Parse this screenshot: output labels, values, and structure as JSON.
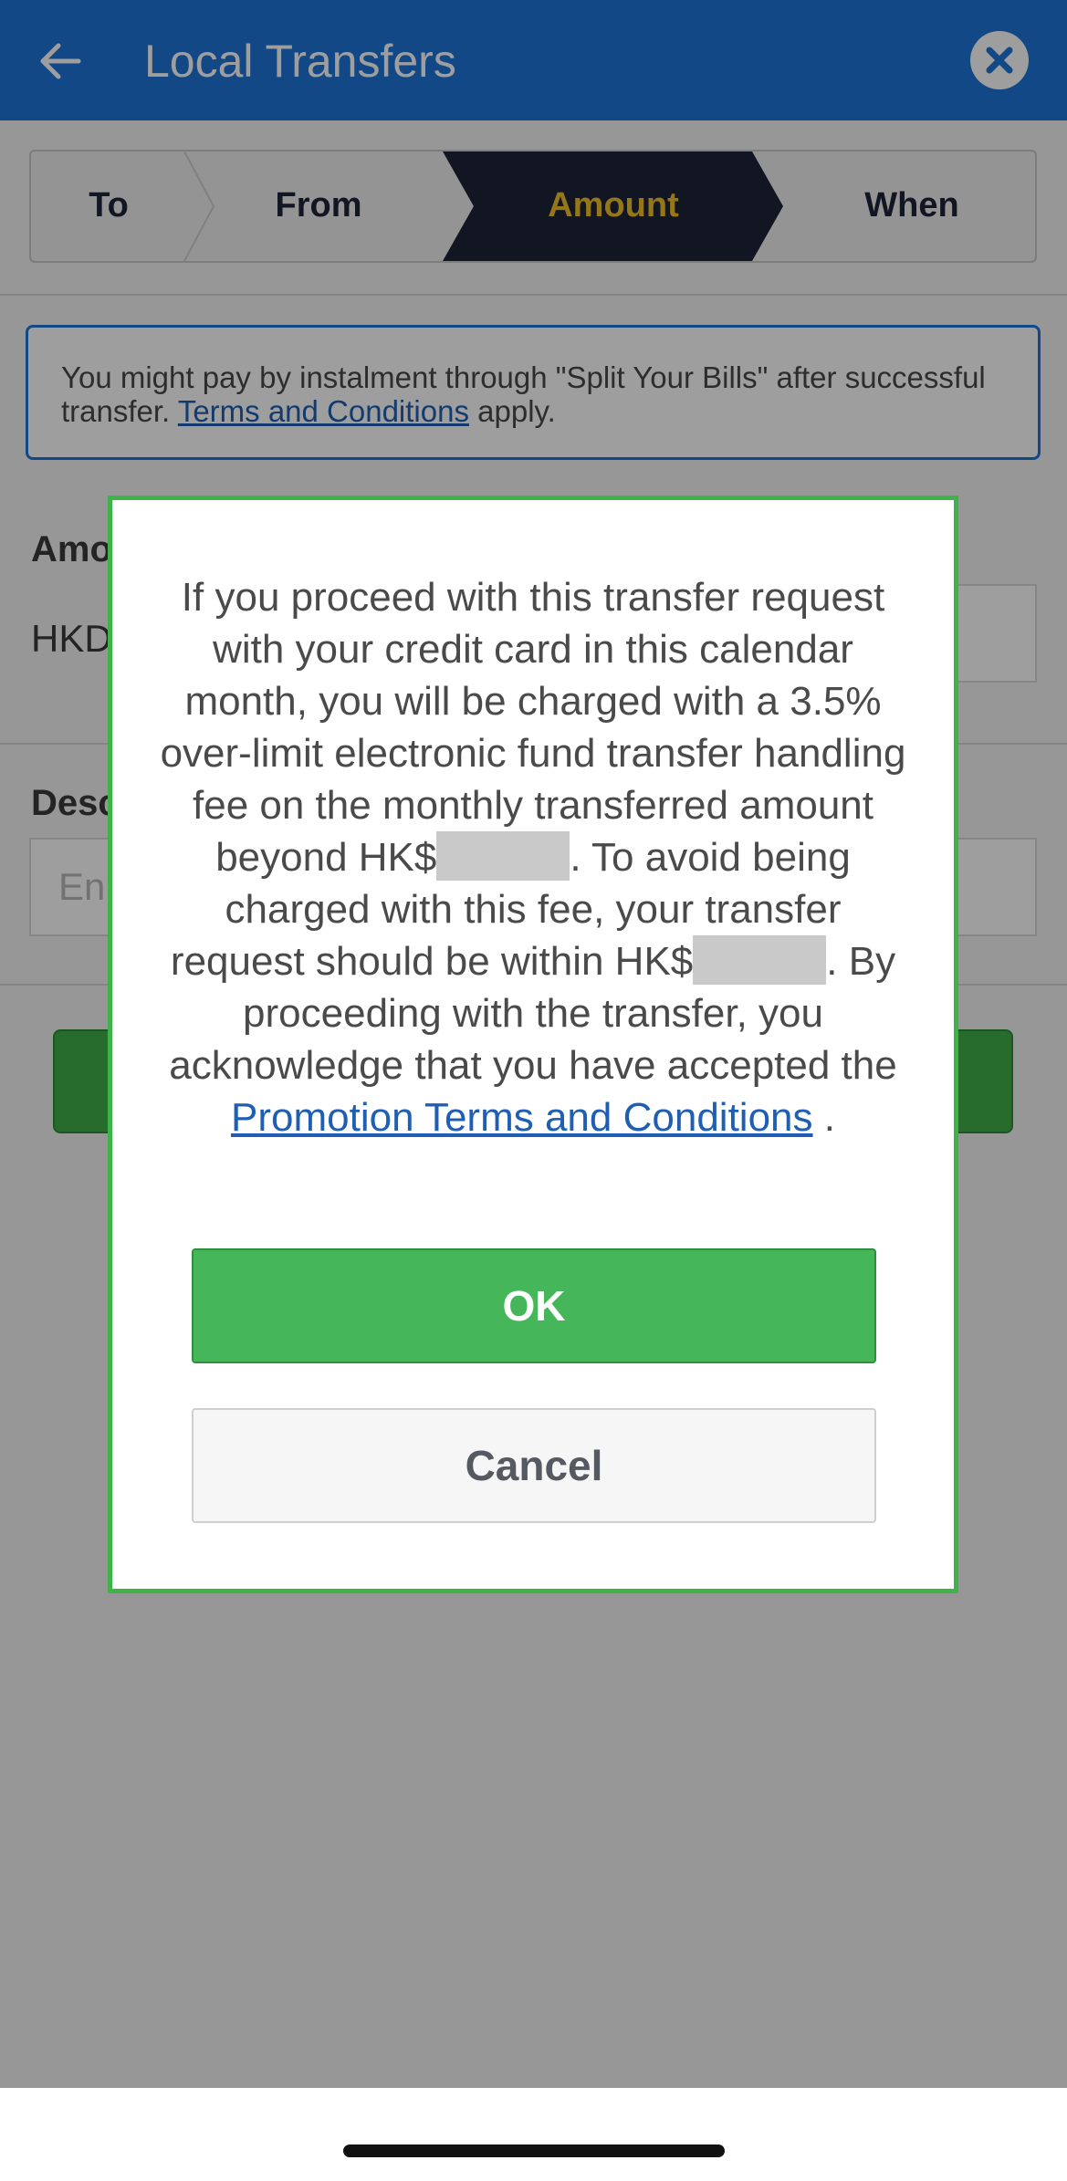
{
  "header": {
    "title": "Local Transfers",
    "color": "#1f75d8"
  },
  "stepper": {
    "steps": [
      {
        "label": "To"
      },
      {
        "label": "From"
      },
      {
        "label": "Amount",
        "active": true
      },
      {
        "label": "When"
      }
    ],
    "active_color": "#1d2238",
    "active_text_color": "#f0c02a"
  },
  "notice": {
    "text": "You might pay by instalment through \"Split Your Bills\" after successful transfer.",
    "link": "Terms and Conditions",
    "suffix": "apply."
  },
  "form": {
    "amount_label": "Amo",
    "currency_prefix": "HKD",
    "description_label": "Desc",
    "description_placeholder": "En"
  },
  "dialog": {
    "message_part1": "If you proceed with this transfer request with your credit card in this calendar month, you will be charged with a 3.5% over-limit electronic fund transfer handling fee on the monthly transferred amount beyond HK$",
    "message_part2": ". To avoid being charged with this fee, your transfer request should be within HK$",
    "message_part3": ". By proceeding with the transfer, you acknowledge that you have accepted the",
    "link": "Promotion Terms and Conditions",
    "message_end": ".",
    "ok_label": "OK",
    "cancel_label": "Cancel",
    "ok_color": "#45b75a"
  },
  "icons": {
    "back": "arrow-left-icon",
    "close": "close-icon"
  }
}
